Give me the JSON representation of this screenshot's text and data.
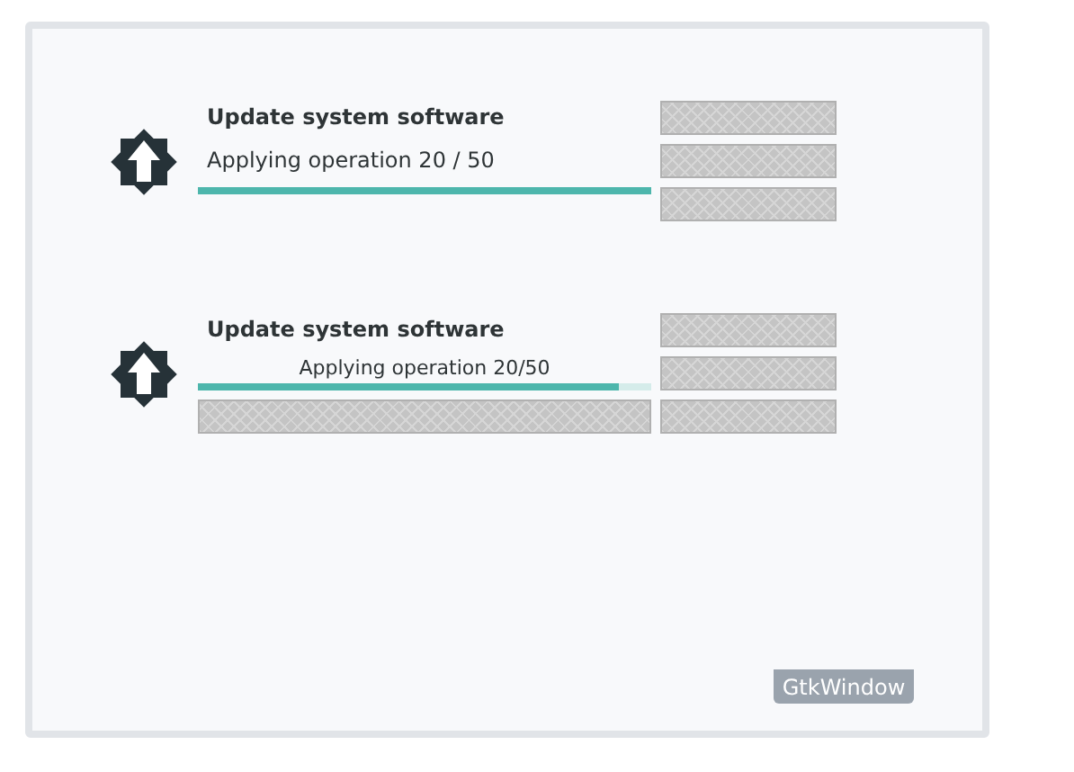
{
  "window": {
    "label": "GtkWindow"
  },
  "tasks": [
    {
      "kind": "plain",
      "title": "Update system software",
      "status": "Applying operation 20 / 50",
      "level": 1.0
    },
    {
      "kind": "inline",
      "title": "Update system software",
      "status": "Applying operation 20/50",
      "level": 0.93
    }
  ]
}
